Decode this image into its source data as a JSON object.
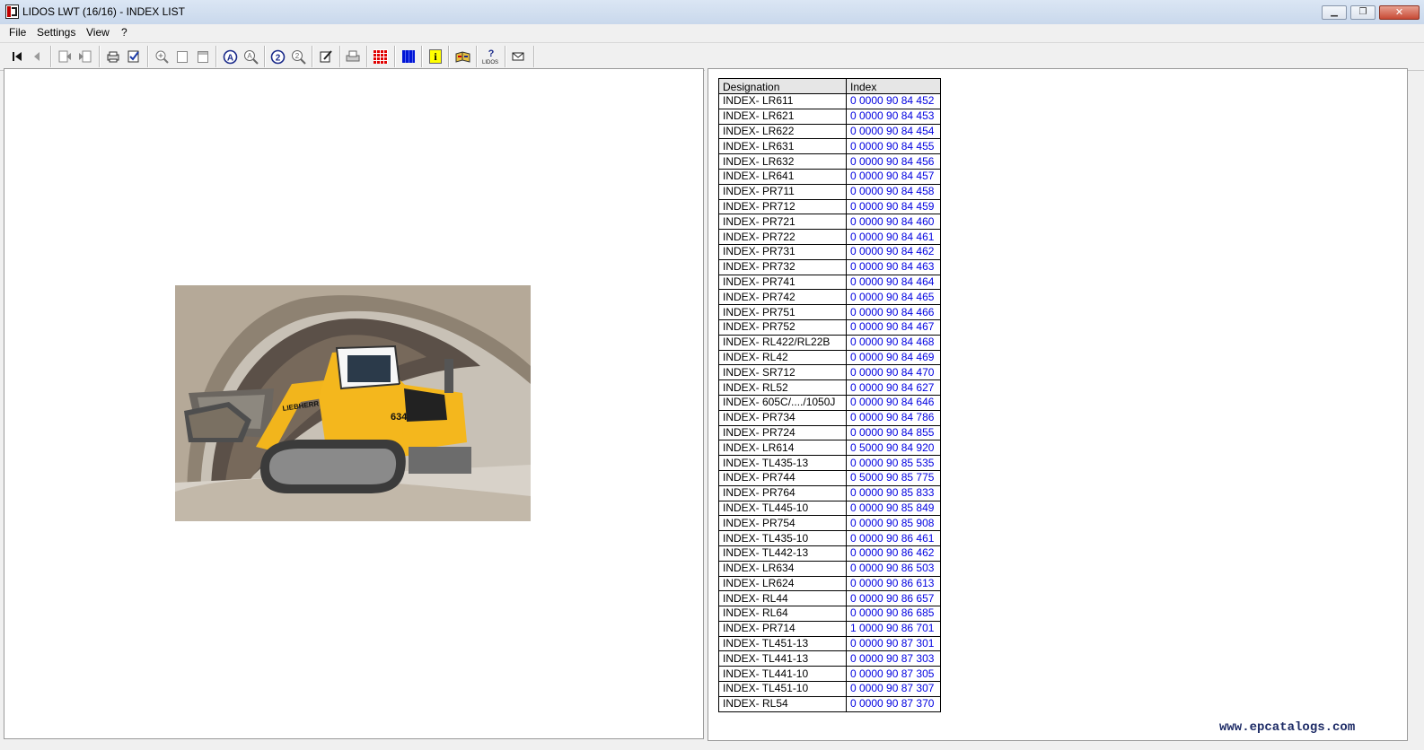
{
  "window": {
    "title": "LIDOS LWT (16/16) - INDEX LIST",
    "minimize_glyph": "▁",
    "maximize_glyph": "❐",
    "close_glyph": "✕"
  },
  "menu": [
    "File",
    "Settings",
    "View",
    "?"
  ],
  "toolbar_icons": [
    "first-page-icon",
    "previous-page-icon",
    "back-icon",
    "forward-icon",
    "print-page-icon",
    "checklist-icon",
    "zoom-in-icon",
    "page-icon",
    "page-icon",
    "a-circle-icon",
    "a-search-icon",
    "2-circle-icon",
    "2-search-icon",
    "edit-icon",
    "printer-icon",
    "red-grid-icon",
    "blue-grid-icon",
    "info-icon",
    "book-icon",
    "lidos-help-icon",
    "mail-icon"
  ],
  "table": {
    "headers": [
      "Designation",
      "Index"
    ],
    "rows": [
      [
        "INDEX- LR611",
        "0 0000 90 84 452"
      ],
      [
        "INDEX- LR621",
        "0 0000 90 84 453"
      ],
      [
        "INDEX- LR622",
        "0 0000 90 84 454"
      ],
      [
        "INDEX- LR631",
        "0 0000 90 84 455"
      ],
      [
        "INDEX- LR632",
        "0 0000 90 84 456"
      ],
      [
        "INDEX- LR641",
        "0 0000 90 84 457"
      ],
      [
        "INDEX- PR711",
        "0 0000 90 84 458"
      ],
      [
        "INDEX- PR712",
        "0 0000 90 84 459"
      ],
      [
        "INDEX- PR721",
        "0 0000 90 84 460"
      ],
      [
        "INDEX- PR722",
        "0 0000 90 84 461"
      ],
      [
        "INDEX- PR731",
        "0 0000 90 84 462"
      ],
      [
        "INDEX- PR732",
        "0 0000 90 84 463"
      ],
      [
        "INDEX- PR741",
        "0 0000 90 84 464"
      ],
      [
        "INDEX- PR742",
        "0 0000 90 84 465"
      ],
      [
        "INDEX- PR751",
        "0 0000 90 84 466"
      ],
      [
        "INDEX- PR752",
        "0 0000 90 84 467"
      ],
      [
        "INDEX- RL422/RL22B",
        "0 0000 90 84 468"
      ],
      [
        "INDEX- RL42",
        "0 0000 90 84 469"
      ],
      [
        "INDEX- SR712",
        "0 0000 90 84 470"
      ],
      [
        "INDEX- RL52",
        "0 0000 90 84 627"
      ],
      [
        "INDEX- 605C/..../1050J",
        "0 0000 90 84 646"
      ],
      [
        "INDEX- PR734",
        "0 0000 90 84 786"
      ],
      [
        "INDEX- PR724",
        "0 0000 90 84 855"
      ],
      [
        "INDEX- LR614",
        "0 5000 90 84 920"
      ],
      [
        "INDEX- TL435-13",
        "0 0000 90 85 535"
      ],
      [
        "INDEX- PR744",
        "0 5000 90 85 775"
      ],
      [
        "INDEX- PR764",
        "0 0000 90 85 833"
      ],
      [
        "INDEX- TL445-10",
        "0 0000 90 85 849"
      ],
      [
        "INDEX- PR754",
        "0 0000 90 85 908"
      ],
      [
        "INDEX- TL435-10",
        "0 0000 90 86 461"
      ],
      [
        "INDEX- TL442-13",
        "0 0000 90 86 462"
      ],
      [
        "INDEX- LR634",
        "0 0000 90 86 503"
      ],
      [
        "INDEX- LR624",
        "0 0000 90 86 613"
      ],
      [
        "INDEX- RL44",
        "0 0000 90 86 657"
      ],
      [
        "INDEX- RL64",
        "0 0000 90 86 685"
      ],
      [
        "INDEX- PR714",
        "1 0000 90 86 701"
      ],
      [
        "INDEX- TL451-13",
        "0 0000 90 87 301"
      ],
      [
        "INDEX- TL441-13",
        "0 0000 90 87 303"
      ],
      [
        "INDEX- TL441-10",
        "0 0000 90 87 305"
      ],
      [
        "INDEX- TL451-10",
        "0 0000 90 87 307"
      ],
      [
        "INDEX- RL54",
        "0 0000 90 87 370"
      ]
    ]
  },
  "photo": {
    "brand": "LIEBHERR",
    "model": "634"
  },
  "watermark": "www.epcatalogs.com"
}
